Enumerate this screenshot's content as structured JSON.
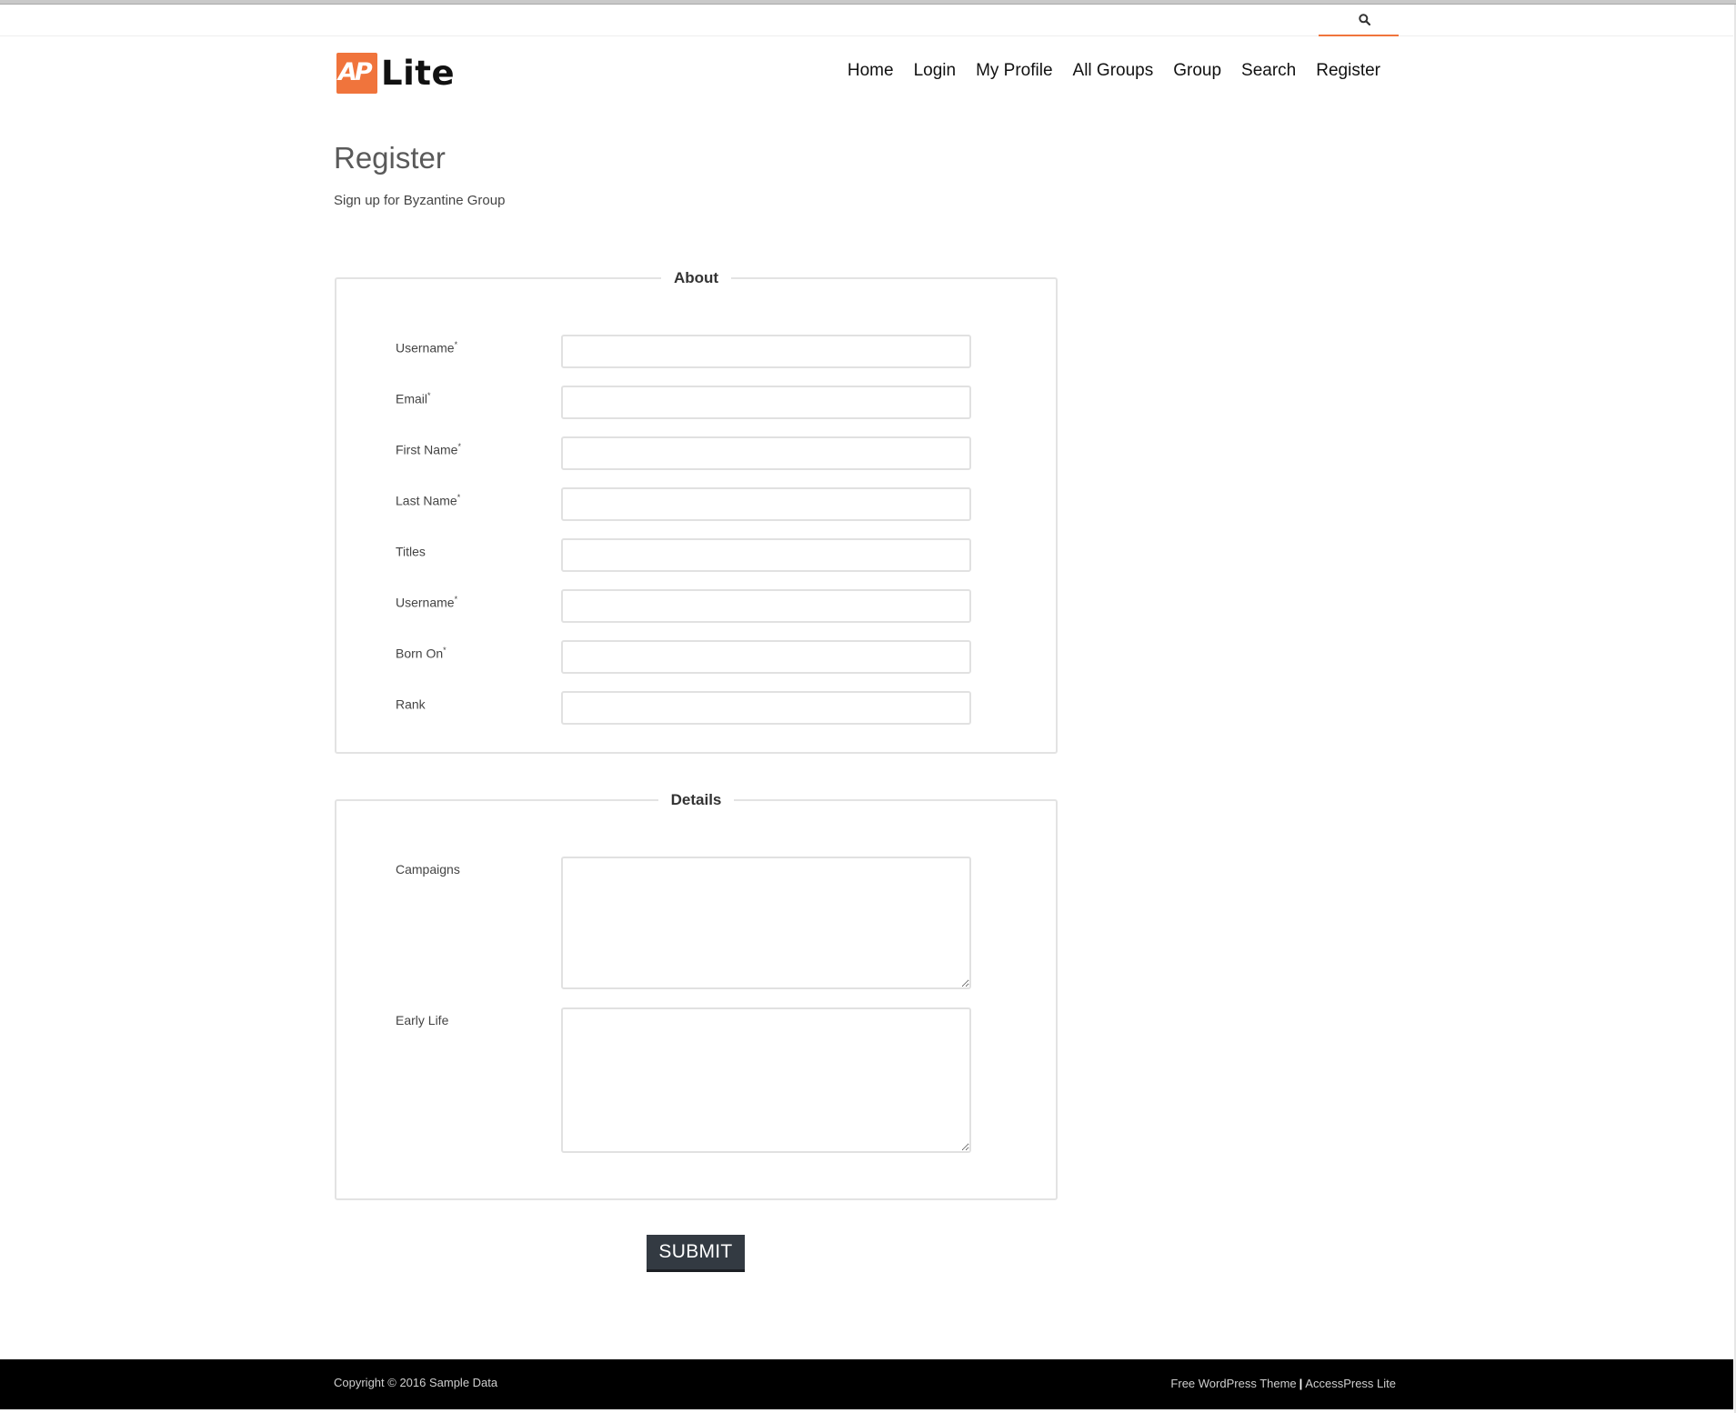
{
  "topbar": {
    "search_icon": "search-icon"
  },
  "logo": {
    "mark": "AP",
    "text": "Lite"
  },
  "nav": {
    "items": [
      {
        "label": "Home"
      },
      {
        "label": "Login"
      },
      {
        "label": "My Profile"
      },
      {
        "label": "All Groups"
      },
      {
        "label": "Group"
      },
      {
        "label": "Search"
      },
      {
        "label": "Register"
      }
    ]
  },
  "page": {
    "title": "Register",
    "subtitle": "Sign up for Byzantine Group"
  },
  "about": {
    "legend": "About",
    "fields": [
      {
        "label": "Username",
        "required": "*",
        "value": ""
      },
      {
        "label": "Email",
        "required": "*",
        "value": ""
      },
      {
        "label": "First Name",
        "required": "*",
        "value": ""
      },
      {
        "label": "Last Name",
        "required": "*",
        "value": ""
      },
      {
        "label": "Titles",
        "required": "",
        "value": ""
      },
      {
        "label": "Username",
        "required": "*",
        "value": ""
      },
      {
        "label": "Born On",
        "required": "*",
        "value": ""
      },
      {
        "label": "Rank",
        "required": "",
        "value": ""
      }
    ]
  },
  "details": {
    "legend": "Details",
    "fields": [
      {
        "label": "Campaigns",
        "value": ""
      },
      {
        "label": "Early Life",
        "value": ""
      }
    ]
  },
  "form": {
    "submit_label": "SUBMIT"
  },
  "footer": {
    "copyright": "Copyright © 2016 Sample Data",
    "theme_link": "Free WordPress Theme",
    "separator": "|",
    "brand_link": "AccessPress Lite"
  },
  "colors": {
    "accent": "#f0743c",
    "submit_bg": "#333a42",
    "footer_bg": "#000000"
  }
}
